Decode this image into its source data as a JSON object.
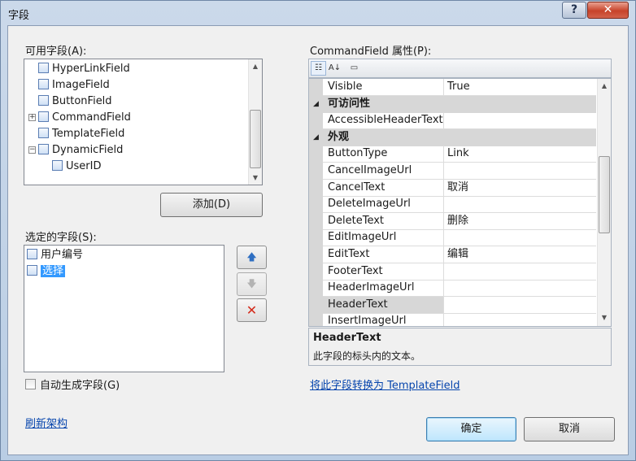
{
  "window": {
    "title": "字段",
    "help_glyph": "?",
    "close_glyph": "✕"
  },
  "available": {
    "label": "可用字段(A):",
    "items": [
      {
        "label": "HyperLinkField",
        "icon": "hyperlink-field-icon",
        "indent": 1
      },
      {
        "label": "ImageField",
        "icon": "image-field-icon",
        "indent": 1
      },
      {
        "label": "ButtonField",
        "icon": "button-field-icon",
        "indent": 1
      },
      {
        "label": "CommandField",
        "icon": "command-field-icon",
        "indent": 1,
        "expander": "+"
      },
      {
        "label": "TemplateField",
        "icon": "template-field-icon",
        "indent": 1
      },
      {
        "label": "DynamicField",
        "icon": "dynamic-field-icon",
        "indent": 1,
        "expander": "−"
      },
      {
        "label": "UserID",
        "icon": "userid-field-icon",
        "indent": 2
      }
    ],
    "add_button": "添加(D)"
  },
  "selected": {
    "label": "选定的字段(S):",
    "items": [
      {
        "label": "用户编号",
        "icon": "bound-field-icon",
        "selected": false
      },
      {
        "label": "选择",
        "icon": "command-field-icon",
        "selected": true
      }
    ],
    "move_up_glyph": "🡅",
    "move_down_glyph": "🡇",
    "delete_glyph": "✕"
  },
  "auto_generate": {
    "label": "自动生成字段(G)",
    "checked": false
  },
  "refresh_link": "刷新架构",
  "properties": {
    "label": "CommandField 属性(P):",
    "rows": [
      {
        "type": "prop",
        "name": "Visible",
        "value": "True"
      },
      {
        "type": "cat",
        "name": "可访问性"
      },
      {
        "type": "prop",
        "name": "AccessibleHeaderText",
        "value": ""
      },
      {
        "type": "cat",
        "name": "外观"
      },
      {
        "type": "prop",
        "name": "ButtonType",
        "value": "Link"
      },
      {
        "type": "prop",
        "name": "CancelImageUrl",
        "value": ""
      },
      {
        "type": "prop",
        "name": "CancelText",
        "value": "取消"
      },
      {
        "type": "prop",
        "name": "DeleteImageUrl",
        "value": ""
      },
      {
        "type": "prop",
        "name": "DeleteText",
        "value": "删除"
      },
      {
        "type": "prop",
        "name": "EditImageUrl",
        "value": ""
      },
      {
        "type": "prop",
        "name": "EditText",
        "value": "编辑"
      },
      {
        "type": "prop",
        "name": "FooterText",
        "value": ""
      },
      {
        "type": "prop",
        "name": "HeaderImageUrl",
        "value": ""
      },
      {
        "type": "prop",
        "name": "HeaderText",
        "value": "",
        "selected": true
      },
      {
        "type": "prop",
        "name": "InsertImageUrl",
        "value": ""
      }
    ],
    "description_title": "HeaderText",
    "description_text": "此字段的标头内的文本。",
    "convert_link": "将此字段转换为 TemplateField",
    "category_glyph": "◢"
  },
  "buttons": {
    "ok": "确定",
    "cancel": "取消"
  },
  "colors": {
    "selection": "#3399ff",
    "link": "#0645ad",
    "delete_red": "#d42a1a",
    "arrow_blue": "#2f6fc2"
  }
}
